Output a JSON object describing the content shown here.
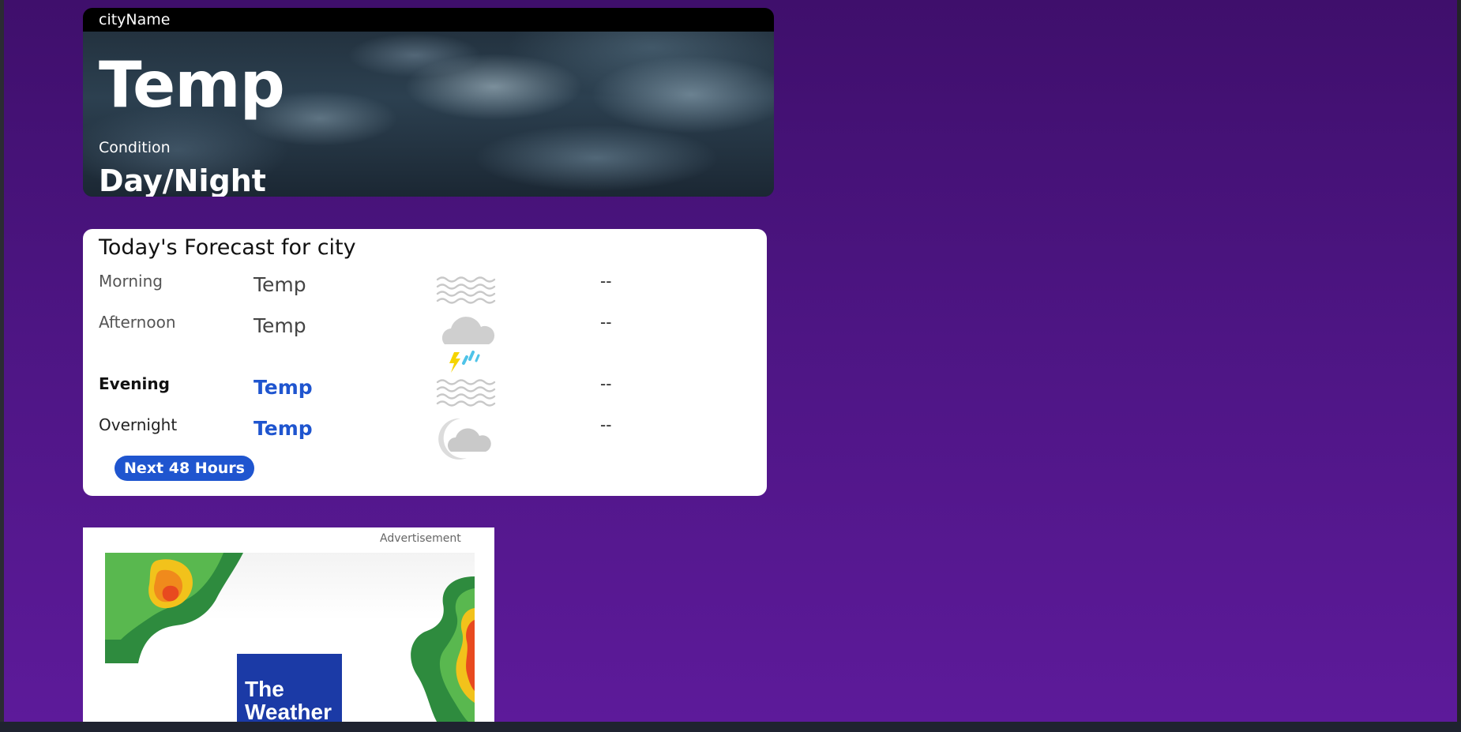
{
  "hero": {
    "city": "cityName",
    "temp": "Temp",
    "condition": "Condition",
    "day_night": "Day/Night"
  },
  "forecast": {
    "title": "Today's Forecast for city",
    "rows": [
      {
        "period": "Morning",
        "temp": "Temp",
        "icon": "fog-icon",
        "precip": "--"
      },
      {
        "period": "Afternoon",
        "temp": "Temp",
        "icon": "thunderstorm-icon",
        "precip": "--"
      },
      {
        "period": "Evening",
        "temp": "Temp",
        "icon": "fog-icon",
        "precip": "--"
      },
      {
        "period": "Overnight",
        "temp": "Temp",
        "icon": "cloudy-night-icon",
        "precip": "--"
      }
    ],
    "next_button": "Next 48 Hours"
  },
  "ad": {
    "label": "Advertisement",
    "logo_text": "The Weather"
  },
  "colors": {
    "accent": "#1f55cf",
    "background_top": "#3f0f6c",
    "background_bottom": "#5d1a9a"
  }
}
